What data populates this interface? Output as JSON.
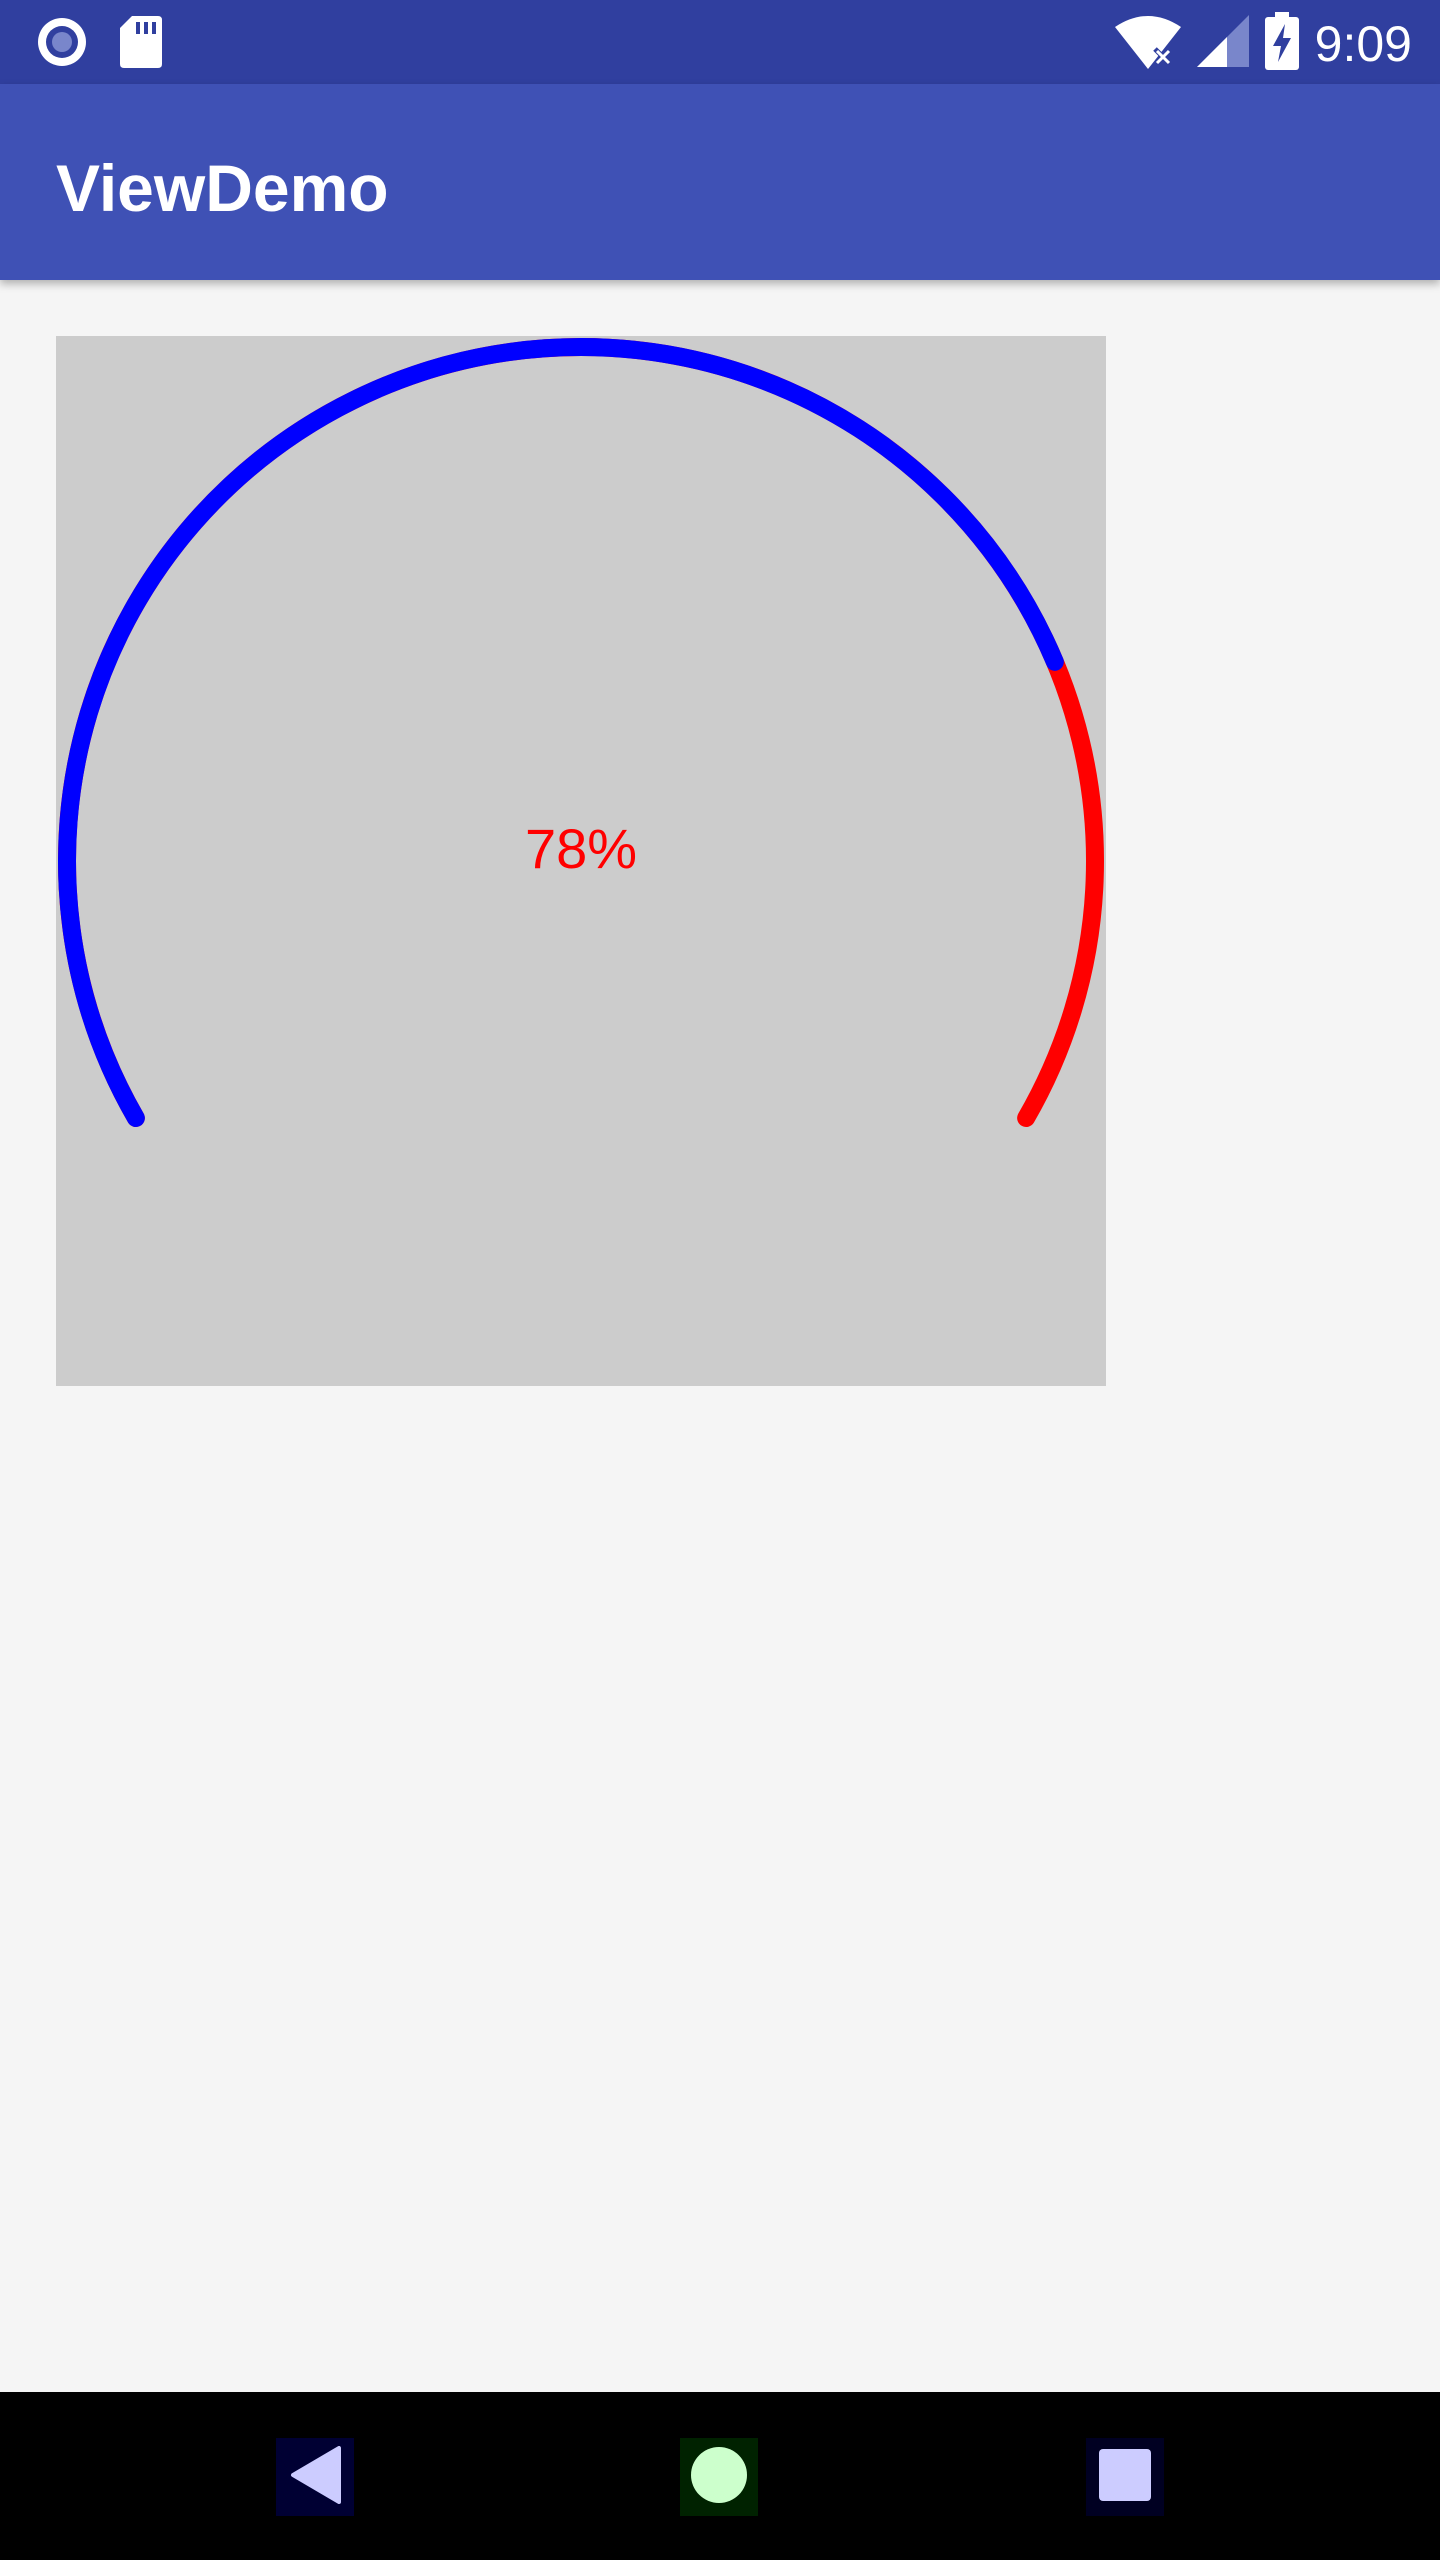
{
  "status_bar": {
    "time": "9:09",
    "icons": [
      "sync-icon",
      "sd-card-icon",
      "wifi-off-icon",
      "cell-signal-icon",
      "battery-charging-icon"
    ]
  },
  "app_bar": {
    "title": "ViewDemo"
  },
  "gauge": {
    "value_label": "78%",
    "progress": 0.78,
    "track_color": "#ff0000",
    "progress_color": "#0000ff",
    "background_color": "#cccccc",
    "sweep_degrees": 240
  },
  "nav_bar": {
    "buttons": [
      "back-icon",
      "home-icon",
      "recents-icon"
    ]
  }
}
